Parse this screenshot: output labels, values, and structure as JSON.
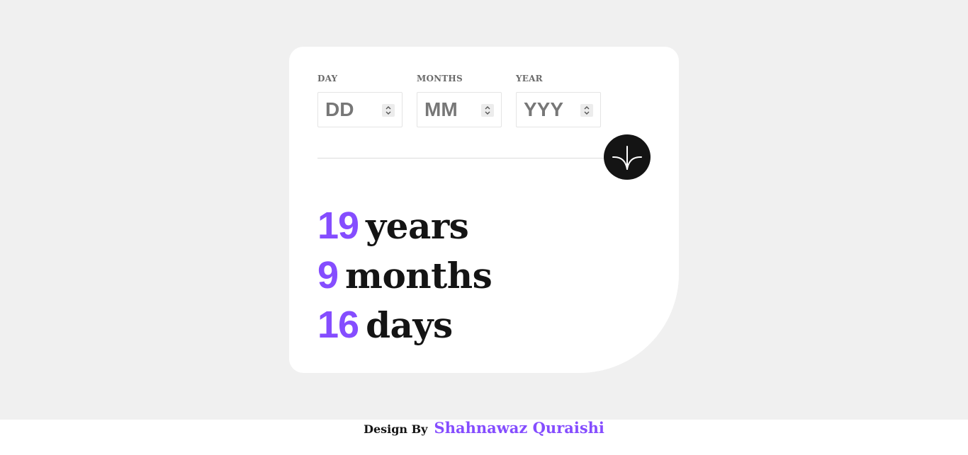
{
  "form": {
    "day": {
      "label": "DAY",
      "placeholder": "DD",
      "value": ""
    },
    "month": {
      "label": "MONTHS",
      "placeholder": "MM",
      "value": ""
    },
    "year": {
      "label": "YEAR",
      "placeholder": "YYY",
      "value": ""
    }
  },
  "submit": {
    "icon": "arrow-down-icon"
  },
  "results": {
    "years": {
      "value": "19",
      "unit": "years"
    },
    "months": {
      "value": "9",
      "unit": "months"
    },
    "days": {
      "value": "16",
      "unit": "days"
    }
  },
  "footer": {
    "prefix": "Design By",
    "author": "Shahnawaz Quraishi"
  },
  "colors": {
    "accent": "#854dff",
    "background": "#f0f0f0",
    "card": "#ffffff",
    "button": "#141414"
  }
}
